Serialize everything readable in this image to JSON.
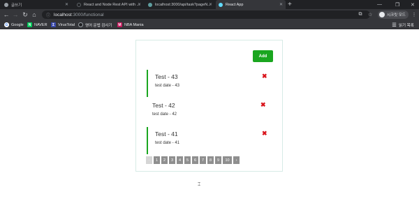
{
  "browser": {
    "tabs": [
      {
        "title": "글쓰기",
        "active": false
      },
      {
        "title": "React and Node Rest API with ...",
        "active": false
      },
      {
        "title": "localhost:3000/api/task?pageN...",
        "active": false
      },
      {
        "title": "React App",
        "active": true
      }
    ],
    "url_host": "localhost",
    "url_path": ":3000/functional",
    "profile_label": "시크릿 모드",
    "bookmarks": [
      {
        "label": "Google",
        "icon": "google-icon",
        "color": "#4285f4"
      },
      {
        "label": "NAVER",
        "icon": "naver-icon",
        "color": "#03c75a"
      },
      {
        "label": "VirusTotal",
        "icon": "virustotal-icon",
        "color": "#3949ab"
      },
      {
        "label": "영어 문법 검사기",
        "icon": "grammar-checker-icon",
        "color": "#202124"
      },
      {
        "label": "NBA Mania",
        "icon": "nba-mania-icon",
        "color": "#c2185b"
      }
    ],
    "reading_list_label": "읽기 목록"
  },
  "page": {
    "add_label": "Add",
    "tasks": [
      {
        "title": "Test - 43",
        "date": "test date - 43",
        "selected": true
      },
      {
        "title": "Test - 42",
        "date": "test date - 42",
        "selected": false
      },
      {
        "title": "Test - 41",
        "date": "test date - 41",
        "selected": true
      }
    ],
    "delete_glyph": "✖",
    "pagination": {
      "prev": "‹",
      "pages": [
        "1",
        "2",
        "3",
        "4",
        "5",
        "6",
        "7",
        "8",
        "9",
        "10"
      ],
      "next": "›",
      "current": "1"
    }
  },
  "colors": {
    "accent_green": "#1aa61f",
    "delete_red": "#d9131a",
    "pager_gray": "#8f8f8f"
  }
}
